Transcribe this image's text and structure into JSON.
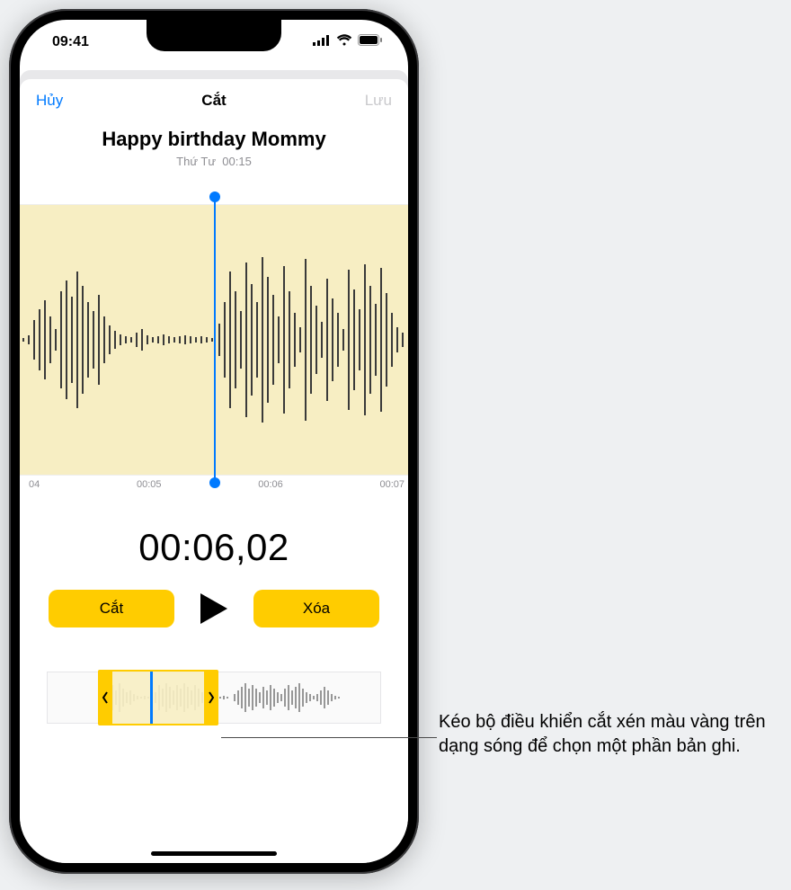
{
  "status": {
    "time": "09:41"
  },
  "nav": {
    "cancel": "Hủy",
    "title": "Cắt",
    "save": "Lưu"
  },
  "recording": {
    "title": "Happy birthday Mommy",
    "day": "Thứ Tư",
    "duration": "00:15"
  },
  "ticks": {
    "t0": "04",
    "t1": "00:05",
    "t2": "00:06",
    "t3": "00:07"
  },
  "timer": "00:06,02",
  "buttons": {
    "trim": "Cắt",
    "delete": "Xóa"
  },
  "callout": "Kéo bộ điều khiển cắt xén màu vàng trên dạng sóng để chọn một phần bản ghi."
}
